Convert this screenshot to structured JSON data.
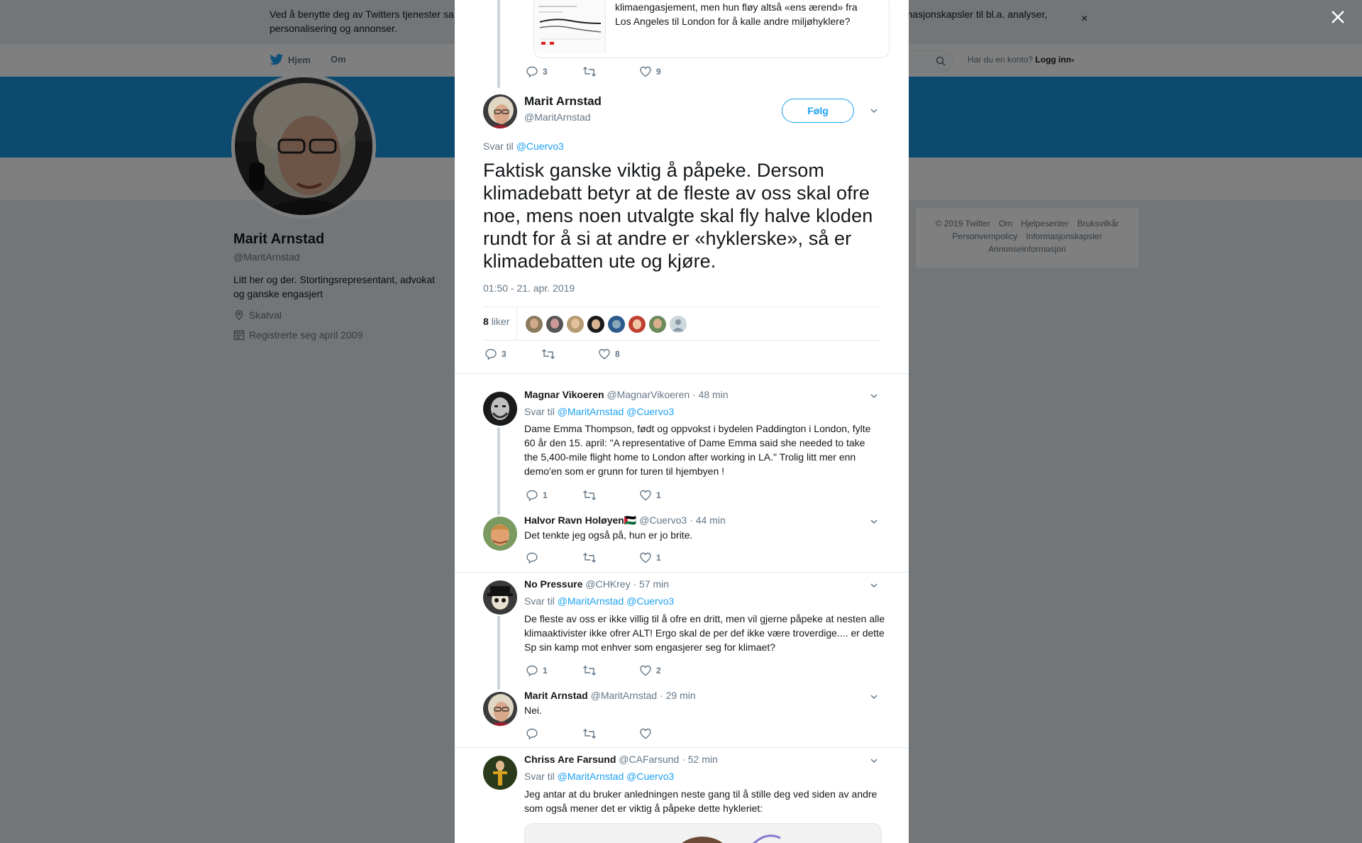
{
  "cookie": {
    "text_start": "Ved å benytte deg av Twitters tjenester sa",
    "text_end": "informasjonskapsler til bl.a. analyser,",
    "text_line2": "personalisering og annonser.",
    "close": "×"
  },
  "nav": {
    "home": "Hjem",
    "about": "Om",
    "login_prompt": "Har du en konto?",
    "login": "Logg inn"
  },
  "profile": {
    "name": "Marit Arnstad",
    "handle": "@MaritArnstad",
    "bio": "Litt her og der. Stortingsrepresentant, advokat og ganske engasjert",
    "location": "Skatval",
    "joined": "Registrerte seg april 2009"
  },
  "footer": {
    "row1": [
      "© 2019 Twitter",
      "Om",
      "Hjelpesenter",
      "Bruksvilkår"
    ],
    "row2": [
      "Personvernpolicy",
      "Informasjonskapsler"
    ],
    "row3": [
      "Annonseinformasjon"
    ]
  },
  "parent_tweet": {
    "text_lines": [
      "klimaengasjement, men hun fløy altså «ens ærend» fra",
      "Los Angeles til London for å kalle andre miljøhyklere?"
    ],
    "replies": "3",
    "retweets": "",
    "likes": "9"
  },
  "main_tweet": {
    "name": "Marit Arnstad",
    "handle": "@MaritArnstad",
    "follow": "Følg",
    "reply_prefix": "Svar til",
    "reply_to": "@Cuervo3",
    "text": "Faktisk ganske viktig å påpeke. Dersom klimadebatt betyr at de fleste av oss skal ofre noe, mens noen utvalgte skal fly halve kloden rundt for å si at andre er «hyklerske», så er klimadebatten ute og kjøre.",
    "timestamp": "01:50 - 21. apr. 2019",
    "likes_count": "8",
    "likes_label": "liker",
    "replies": "3",
    "retweets": "",
    "likes": "8"
  },
  "replies": [
    {
      "name": "Magnar Vikoeren",
      "handle": "@MagnarVikoeren",
      "time": "· 48 min",
      "reply_prefix": "Svar til",
      "reply_to": "@MaritArnstad @Cuervo3",
      "text": "Dame Emma Thompson, født og oppvokst i bydelen Paddington i London, fylte 60 år den 15. april: \"A representative of Dame Emma said she needed to take the 5,400-mile flight home to London after working in LA.\" Trolig litt mer enn demo'en som er grunn for turen til hjembyen !",
      "replies": "1",
      "retweets": "",
      "likes": "1"
    },
    {
      "name": "Halvor Ravn Holøyen🇵🇸",
      "handle": "@Cuervo3",
      "time": "· 44 min",
      "text": "Det tenkte jeg også på, hun er jo brite.",
      "replies": "",
      "retweets": "",
      "likes": "1"
    },
    {
      "name": "No Pressure",
      "handle": "@CHKrey",
      "time": "· 57 min",
      "reply_prefix": "Svar til",
      "reply_to": "@MaritArnstad @Cuervo3",
      "text": "De fleste av oss er ikke villig til å ofre en dritt, men vil gjerne påpeke at nesten alle klimaaktivister ikke ofrer ALT! Ergo skal de per def ikke være troverdige.... er dette Sp sin kamp mot enhver som engasjerer seg for klimaet?",
      "replies": "1",
      "retweets": "",
      "likes": "2"
    },
    {
      "name": "Marit Arnstad",
      "handle": "@MaritArnstad",
      "time": "· 29 min",
      "text": "Nei.",
      "replies": "",
      "retweets": "",
      "likes": ""
    },
    {
      "name": "Chriss Are Farsund",
      "handle": "@CAFarsund",
      "time": "· 52 min",
      "reply_prefix": "Svar til",
      "reply_to": "@MaritArnstad @Cuervo3",
      "text": "Jeg antar at du bruker anledningen neste gang til å stille deg ved siden av andre som også mener det er viktig å påpeke dette hykleriet:",
      "replies": "",
      "retweets": "",
      "likes": ""
    }
  ],
  "colors": {
    "accent": "#1da1f2",
    "banner": "#1b95e0",
    "text": "#14171a",
    "muted": "#657786",
    "thread": "#ccd6dd"
  },
  "icons": [
    "twitter-bird-icon",
    "search-icon",
    "close-icon",
    "location-icon",
    "calendar-icon",
    "reply-icon",
    "retweet-icon",
    "heart-icon",
    "chevron-down-icon"
  ]
}
